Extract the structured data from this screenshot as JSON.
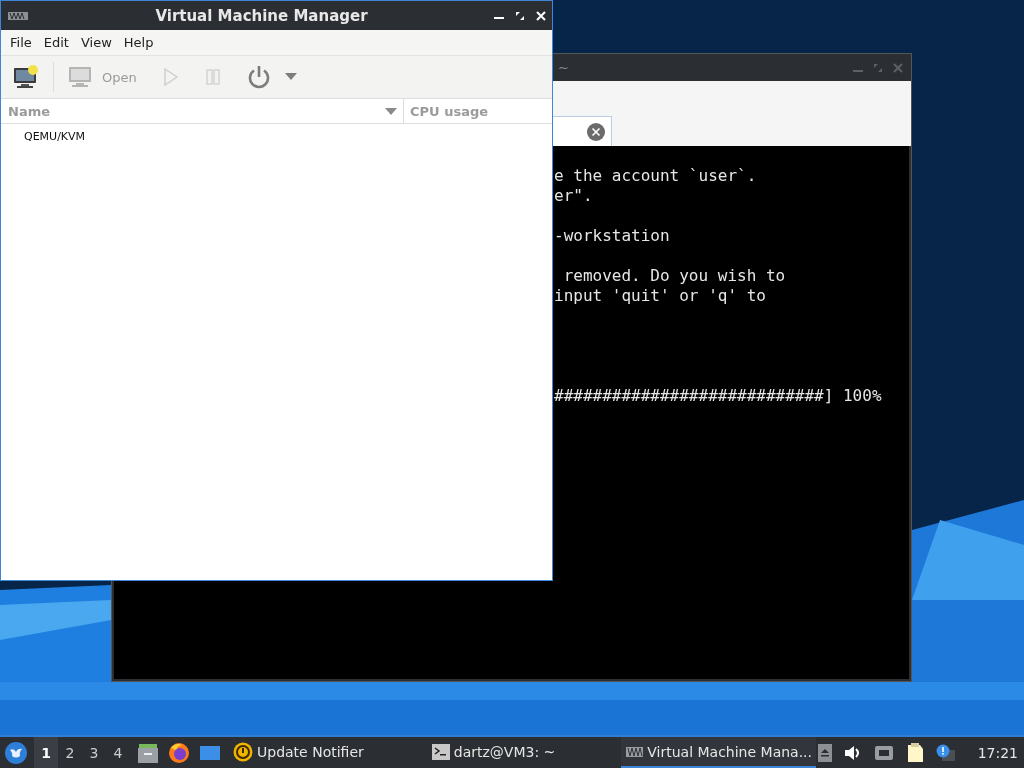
{
  "vmm_window": {
    "title": "Virtual Machine Manager",
    "menu": [
      "File",
      "Edit",
      "View",
      "Help"
    ],
    "toolbar": {
      "open_label": "Open"
    },
    "columns": [
      "Name",
      "CPU usage"
    ],
    "connections": [
      {
        "name": "QEMU/KVM"
      }
    ]
  },
  "terminal_window": {
    "title": "~",
    "lines": [
      {
        "kind": "text",
        "text": "e the account `user`."
      },
      {
        "kind": "text",
        "text": "er\"."
      },
      {
        "kind": "blank"
      },
      {
        "kind": "text",
        "text": "-workstation"
      },
      {
        "kind": "blank"
      },
      {
        "kind": "text",
        "text": " removed. Do you wish to"
      },
      {
        "kind": "text",
        "text": "input 'quit' or 'q' to"
      },
      {
        "kind": "blank"
      },
      {
        "kind": "blank"
      },
      {
        "kind": "blank"
      },
      {
        "kind": "blank"
      },
      {
        "kind": "text",
        "text": "############################] 100%"
      }
    ]
  },
  "taskbar": {
    "workspaces": [
      {
        "label": "1",
        "selected": true
      },
      {
        "label": "2",
        "selected": false
      },
      {
        "label": "3",
        "selected": false
      },
      {
        "label": "4",
        "selected": false
      }
    ],
    "launchers": [
      {
        "kind": "files"
      },
      {
        "kind": "browser"
      },
      {
        "kind": "desktop"
      }
    ],
    "tasks": [
      {
        "kind": "notifier",
        "label": "Update Notifier",
        "selected": false
      },
      {
        "kind": "terminal",
        "label": "dartz@VM3: ~",
        "selected": false
      },
      {
        "kind": "vmm",
        "label": "Virtual Machine Mana...",
        "selected": true
      }
    ],
    "clock": "17:21"
  }
}
